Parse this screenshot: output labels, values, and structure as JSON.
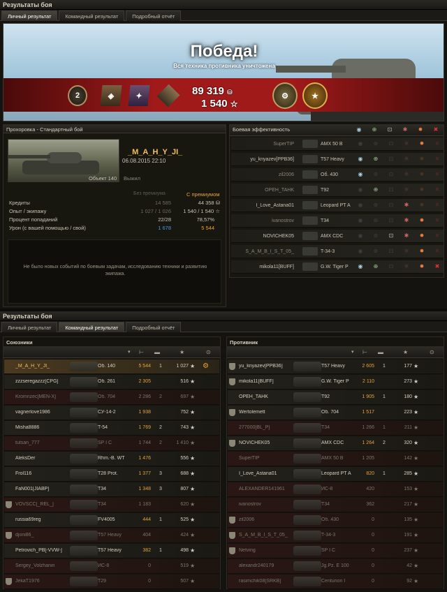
{
  "window1": {
    "title": "Результаты боя",
    "tabs": [
      "Личный результат",
      "Командный результат",
      "Подробный отчёт"
    ]
  },
  "banner": {
    "headline": "Победа!",
    "subtitle": "Вся техника противника уничтожена",
    "credits": "89 319",
    "xp": "1 540",
    "level_badge": "2",
    "star_icon": "☆"
  },
  "battle": {
    "header": "Прохоровка - Стандартный бой",
    "player": "_M_A_H_Y_JI_",
    "datetime": "06.08.2015 22:10",
    "vehicle": "Объект 140",
    "status": "Выжил"
  },
  "stats": {
    "col1": "Без премиума",
    "col2": "С премиумом",
    "rows": [
      {
        "label": "Кредиты",
        "v1": "14 585",
        "v2": "44 358"
      },
      {
        "label": "Опыт / экипажу",
        "v1": "1 027 / 1 026",
        "v2": "1 540 / 1 540"
      },
      {
        "label": "Процент попаданий",
        "v1": "22/28",
        "v2": "78,57%"
      },
      {
        "label": "Урон (с вашей помощью / свой)",
        "v1": "1 678",
        "v2": "5 544"
      }
    ],
    "note": "Не было новых событий по боевым задачам, исследованию техники и развитию экипажа."
  },
  "efficiency": {
    "header": "Боевая эффективность",
    "rows": [
      {
        "player": "SuperTIP",
        "vehicle": "AMX 50 B"
      },
      {
        "player": "yu_knyazev[PPB36]",
        "vehicle": "T57 Heavy"
      },
      {
        "player": "zil2006",
        "vehicle": "Об. 430"
      },
      {
        "player": "OPEH_TAHK",
        "vehicle": "T92"
      },
      {
        "player": "I_Love_Astana01",
        "vehicle": "Leopard PT A"
      },
      {
        "player": "ivanostrov",
        "vehicle": "T34"
      },
      {
        "player": "NOVICHEK05",
        "vehicle": "AMX CDC"
      },
      {
        "player": "S_A_M_B_I_S_T_05_",
        "vehicle": "T-34-3"
      },
      {
        "player": "mikola11[BUFF]",
        "vehicle": "G.W. Tiger P"
      }
    ]
  },
  "window2": {
    "title": "Результаты боя",
    "tabs": [
      "Личный результат",
      "Командный результат",
      "Подробный отчёт"
    ]
  },
  "allies": {
    "header": "Союзники",
    "players": [
      {
        "name": "_M_A_H_Y_JI_",
        "vehicle": "Об. 140",
        "dmg": "5 544",
        "kills": "1",
        "xp": "1 027"
      },
      {
        "name": "zzzseregazzz[CPG]",
        "vehicle": "Об. 261",
        "dmg": "2 305",
        "kills": "",
        "xp": "516"
      },
      {
        "name": "Kromnzec[MEN-X]",
        "vehicle": "Об. 704",
        "dmg": "2 286",
        "kills": "2",
        "xp": "697"
      },
      {
        "name": "vagnerlove1986",
        "vehicle": "СУ-14-2",
        "dmg": "1 938",
        "kills": "",
        "xp": "752"
      },
      {
        "name": "Misha8886",
        "vehicle": "T-54",
        "dmg": "1 769",
        "kills": "2",
        "xp": "743"
      },
      {
        "name": "tutsan_777",
        "vehicle": "SP I C",
        "dmg": "1 744",
        "kills": "2",
        "xp": "1 410"
      },
      {
        "name": "AleksDer",
        "vehicle": "Rhm.-B. WT",
        "dmg": "1 476",
        "kills": "",
        "xp": "556"
      },
      {
        "name": "Frol116",
        "vehicle": "T28 Prot.",
        "dmg": "1 377",
        "kills": "3",
        "xp": "688"
      },
      {
        "name": "FaN001[JIABP]",
        "vehicle": "T34",
        "dmg": "1 348",
        "kills": "3",
        "xp": "807"
      },
      {
        "name": "VOVSCC[_REL_]",
        "vehicle": "T34",
        "dmg": "1 183",
        "kills": "",
        "xp": "620"
      },
      {
        "name": "russia69reg",
        "vehicle": "FV4005",
        "dmg": "444",
        "kills": "1",
        "xp": "525"
      },
      {
        "name": "djoni86_",
        "vehicle": "T57 Heavy",
        "dmg": "404",
        "kills": "",
        "xp": "424"
      },
      {
        "name": "Petrovich_PB[-VVW-]",
        "vehicle": "T57 Heavy",
        "dmg": "382",
        "kills": "1",
        "xp": "498"
      },
      {
        "name": "Sergey_Volzhanin",
        "vehicle": "ИС-8",
        "dmg": "0",
        "kills": "",
        "xp": "519"
      },
      {
        "name": "JekaT1976",
        "vehicle": "T29",
        "dmg": "0",
        "kills": "",
        "xp": "507"
      }
    ]
  },
  "enemies": {
    "header": "Противник",
    "players": [
      {
        "name": "yu_knyazev[PPB36]",
        "vehicle": "T57 Heavy",
        "dmg": "2 605",
        "kills": "1",
        "xp": "177"
      },
      {
        "name": "mikola11[BUFF]",
        "vehicle": "G.W. Tiger P",
        "dmg": "2 110",
        "kills": "",
        "xp": "273"
      },
      {
        "name": "OPEH_TAHK",
        "vehicle": "T92",
        "dmg": "1 905",
        "kills": "1",
        "xp": "180"
      },
      {
        "name": "Wertolemett",
        "vehicle": "Об. 704",
        "dmg": "1 517",
        "kills": "",
        "xp": "223"
      },
      {
        "name": "277000[BL_P]",
        "vehicle": "T34",
        "dmg": "1 266",
        "kills": "1",
        "xp": "211"
      },
      {
        "name": "NOVICHEK05",
        "vehicle": "AMX CDC",
        "dmg": "1 264",
        "kills": "2",
        "xp": "320"
      },
      {
        "name": "SuperTIP",
        "vehicle": "AMX 50 B",
        "dmg": "1 205",
        "kills": "",
        "xp": "142"
      },
      {
        "name": "I_Love_Astana01",
        "vehicle": "Leopard PT A",
        "dmg": "820",
        "kills": "1",
        "xp": "285"
      },
      {
        "name": "ALEXANDER141961",
        "vehicle": "ИС-8",
        "dmg": "420",
        "kills": "",
        "xp": "153"
      },
      {
        "name": "ivanostrov",
        "vehicle": "T34",
        "dmg": "362",
        "kills": "",
        "xp": "217"
      },
      {
        "name": "zil2006",
        "vehicle": "Об. 430",
        "dmg": "0",
        "kills": "",
        "xp": "135"
      },
      {
        "name": "S_A_M_B_I_S_T_05_",
        "vehicle": "T-34-3",
        "dmg": "0",
        "kills": "",
        "xp": "191"
      },
      {
        "name": "Netving",
        "vehicle": "SP I C",
        "dmg": "0",
        "kills": "",
        "xp": "237"
      },
      {
        "name": "alexandr240179",
        "vehicle": "Jg.Pz. E 100",
        "dmg": "0",
        "kills": "",
        "xp": "42"
      },
      {
        "name": "rasimchik08[SRKB]",
        "vehicle": "Centurion I",
        "dmg": "0",
        "kills": "",
        "xp": "92"
      }
    ]
  },
  "colors": {
    "gold": "#e8a33a",
    "accent_red": "#a11a1a",
    "highlight": "#f0c060",
    "blue_dmg": "#4a9ae0",
    "orange_dmg": "#f0a030"
  }
}
